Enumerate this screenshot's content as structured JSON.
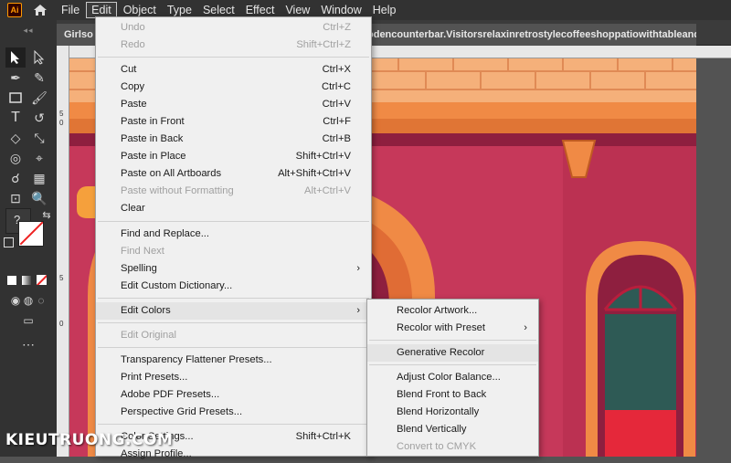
{
  "menubar": {
    "logo": "Ai",
    "items": [
      "File",
      "Edit",
      "Object",
      "Type",
      "Select",
      "Effect",
      "View",
      "Window",
      "Help"
    ]
  },
  "tab": {
    "title_left": "Girlso",
    "title_right": "odencounterbar.Visitorsrelaxinretrostylecoffeeshoppatiowithtableandcha"
  },
  "edit_menu": [
    {
      "label": "Undo",
      "shortcut": "Ctrl+Z",
      "disabled": true
    },
    {
      "label": "Redo",
      "shortcut": "Shift+Ctrl+Z",
      "disabled": true
    },
    {
      "label": "Cut",
      "shortcut": "Ctrl+X"
    },
    {
      "label": "Copy",
      "shortcut": "Ctrl+C"
    },
    {
      "label": "Paste",
      "shortcut": "Ctrl+V"
    },
    {
      "label": "Paste in Front",
      "shortcut": "Ctrl+F"
    },
    {
      "label": "Paste in Back",
      "shortcut": "Ctrl+B"
    },
    {
      "label": "Paste in Place",
      "shortcut": "Shift+Ctrl+V"
    },
    {
      "label": "Paste on All Artboards",
      "shortcut": "Alt+Shift+Ctrl+V"
    },
    {
      "label": "Paste without Formatting",
      "shortcut": "Alt+Ctrl+V",
      "disabled": true
    },
    {
      "label": "Clear",
      "shortcut": ""
    },
    {
      "label": "Find and Replace...",
      "shortcut": ""
    },
    {
      "label": "Find Next",
      "shortcut": "",
      "disabled": true
    },
    {
      "label": "Spelling",
      "shortcut": "",
      "submenu": true
    },
    {
      "label": "Edit Custom Dictionary...",
      "shortcut": ""
    },
    {
      "label": "Edit Colors",
      "shortcut": "",
      "submenu": true,
      "highlighted": true
    },
    {
      "label": "Edit Original",
      "shortcut": "",
      "disabled": true
    },
    {
      "label": "Transparency Flattener Presets...",
      "shortcut": ""
    },
    {
      "label": "Print Presets...",
      "shortcut": ""
    },
    {
      "label": "Adobe PDF Presets...",
      "shortcut": ""
    },
    {
      "label": "Perspective Grid Presets...",
      "shortcut": ""
    },
    {
      "label": "Color Settings...",
      "shortcut": "Shift+Ctrl+K"
    },
    {
      "label": "Assign Profile...",
      "shortcut": ""
    }
  ],
  "edit_colors_submenu": [
    {
      "label": "Recolor Artwork..."
    },
    {
      "label": "Recolor with Preset",
      "submenu": true
    },
    {
      "label": "Generative Recolor",
      "highlighted": true
    },
    {
      "label": "Adjust Color Balance..."
    },
    {
      "label": "Blend Front to Back"
    },
    {
      "label": "Blend Horizontally"
    },
    {
      "label": "Blend Vertically"
    },
    {
      "label": "Convert to CMYK",
      "disabled": true
    }
  ],
  "watermark": "KIEUTRUONG.COM",
  "colors": {
    "menubar_bg": "#323232",
    "wall": "#c6385a",
    "roof": "#f4a064",
    "arrow": "#f0431a"
  }
}
